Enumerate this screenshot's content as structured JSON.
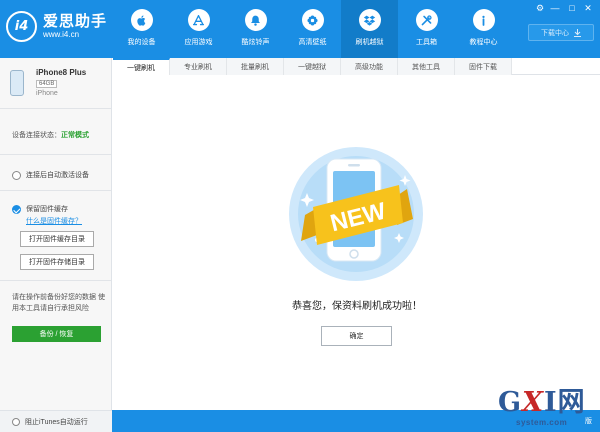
{
  "app": {
    "logo_mark": "i4",
    "name": "爱思助手",
    "url": "www.i4.cn"
  },
  "nav": [
    {
      "label": "我的设备",
      "icon": "apple-icon"
    },
    {
      "label": "应用游戏",
      "icon": "app-store-icon"
    },
    {
      "label": "酷炫铃声",
      "icon": "bell-icon"
    },
    {
      "label": "高清壁纸",
      "icon": "flower-icon"
    },
    {
      "label": "刷机越狱",
      "icon": "dropbox-icon",
      "active": true
    },
    {
      "label": "工具箱",
      "icon": "tools-icon"
    },
    {
      "label": "教程中心",
      "icon": "info-icon"
    }
  ],
  "window_controls": {
    "settings": "⚙",
    "minimize": "—",
    "maximize": "□",
    "close": "✕"
  },
  "download_center": {
    "label": "下载中心",
    "icon": "download-icon"
  },
  "device": {
    "name": "iPhone8 Plus",
    "capacity": "64GB",
    "model": "iPhone"
  },
  "sidebar": {
    "connection_label": "设备连接状态：",
    "connection_status": "正常模式",
    "auto_activate_label": "连接后自动激活设备",
    "keep_firmware_label": "保留固件缓存",
    "keep_firmware_link": "什么是固件缓存？",
    "open_cache_dir": "打开固件缓存目录",
    "open_store_dir": "打开固件存储目录",
    "warning": "请在操作前备份好您的数据 使用本工具请自行承担风险",
    "backup_restore": "备份 / 恢复"
  },
  "tabs": [
    {
      "label": "一键刷机",
      "active": true
    },
    {
      "label": "专业刷机"
    },
    {
      "label": "批量刷机"
    },
    {
      "label": "一键越狱"
    },
    {
      "label": "高级功能"
    },
    {
      "label": "其他工具"
    },
    {
      "label": "固件下载"
    }
  ],
  "main": {
    "badge_text": "NEW",
    "message": "恭喜您，保资料刷机成功啦！",
    "confirm": "确定"
  },
  "footer": {
    "block_itunes": "阻止iTunes自动运行",
    "right_text": "版"
  },
  "watermark": {
    "g": "G",
    "x": "X",
    "i": "I",
    "wang": "网",
    "domain": "system.com"
  },
  "colors": {
    "primary": "#1a8ee4",
    "primary_dark": "#127cc9",
    "success": "#2ba132",
    "ribbon": "#f7c21c"
  }
}
